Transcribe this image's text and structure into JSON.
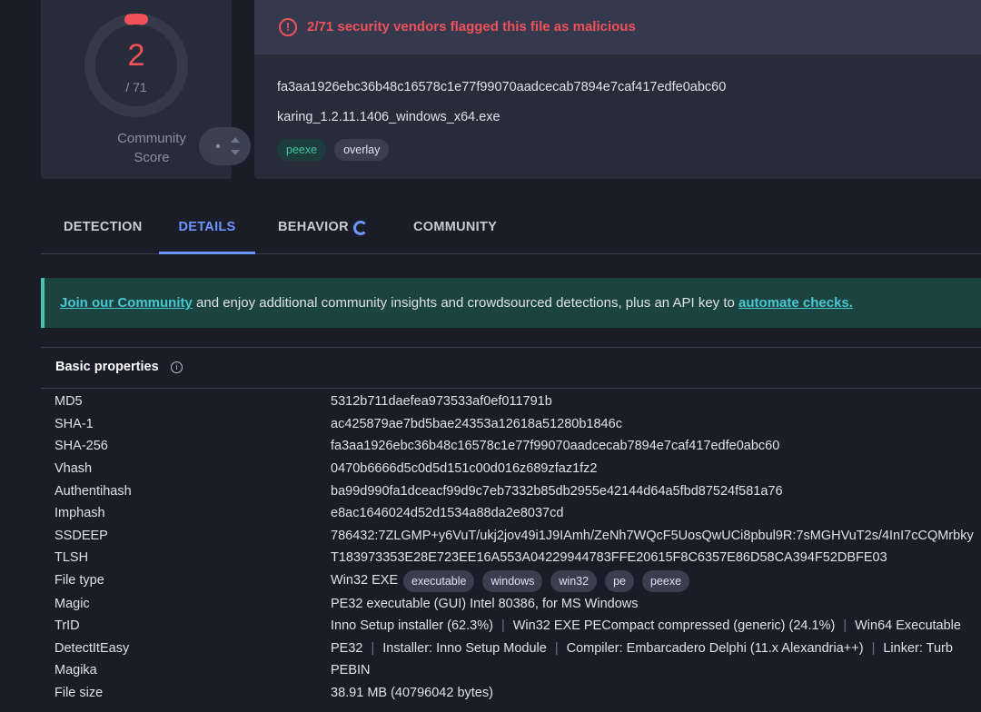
{
  "score": {
    "detections": "2",
    "total": "/ 71",
    "community_label_line1": "Community",
    "community_label_line2": "Score",
    "ring_color": "#f0515a"
  },
  "header": {
    "alert_icon": "!",
    "alert": "2/71 security vendors flagged this file as malicious",
    "sha256": "fa3aa1926ebc36b48c16578c1e77f99070aadcecab7894e7caf417edfe0abc60",
    "file_name": "karing_1.2.11.1406_windows_x64.exe",
    "tags": [
      "peexe",
      "overlay"
    ]
  },
  "tabs": [
    "DETECTION",
    "DETAILS",
    "BEHAVIOR",
    "COMMUNITY"
  ],
  "active_tab": "DETAILS",
  "banner": {
    "link1": "Join our Community",
    "text": " and enjoy additional community insights and crowdsourced detections, plus an API key to ",
    "link2": "automate checks."
  },
  "basic_properties": {
    "title": "Basic properties",
    "info_icon": "i",
    "rows": [
      {
        "key": "MD5",
        "value": "5312b711daefea973533af0ef011791b"
      },
      {
        "key": "SHA-1",
        "value": "ac425879ae7bd5bae24353a12618a51280b1846c"
      },
      {
        "key": "SHA-256",
        "value": "fa3aa1926ebc36b48c16578c1e77f99070aadcecab7894e7caf417edfe0abc60"
      },
      {
        "key": "Vhash",
        "value": "0470b6666d5c0d5d151c00d016z689zfaz1fz2"
      },
      {
        "key": "Authentihash",
        "value": "ba99d990fa1dceacf99d9c7eb7332b85db2955e42144d64a5fbd87524f581a76"
      },
      {
        "key": "Imphash",
        "value": "e8ac1646024d52d1534a88da2e8037cd"
      },
      {
        "key": "SSDEEP",
        "value": "786432:7ZLGMP+y6VuT/ukj2jov49i1J9IAmh/ZeNh7WQcF5UosQwUCi8pbul9R:7sMGHVuT2s/4InI7cCQMrbky"
      },
      {
        "key": "TLSH",
        "value": "T183973353E28E723EE16A553A04229944783FFE20615F8C6357E86D58CA394F52DBFE03"
      },
      {
        "key": "File type",
        "value": "Win32 EXE",
        "chips": [
          "executable",
          "windows",
          "win32",
          "pe",
          "peexe"
        ]
      },
      {
        "key": "Magic",
        "value": "PE32 executable (GUI) Intel 80386, for MS Windows"
      },
      {
        "key": "TrID",
        "parts": [
          "Inno Setup installer (62.3%)",
          "Win32 EXE PECompact compressed (generic) (24.1%)",
          "Win64 Executable"
        ]
      },
      {
        "key": "DetectItEasy",
        "parts": [
          "PE32",
          "Installer: Inno Setup Module",
          "Compiler: Embarcadero Delphi (11.x Alexandria++)",
          "Linker: Turb"
        ]
      },
      {
        "key": "Magika",
        "value": "PEBIN"
      },
      {
        "key": "File size",
        "value": "38.91 MB (40796042 bytes)"
      }
    ]
  }
}
